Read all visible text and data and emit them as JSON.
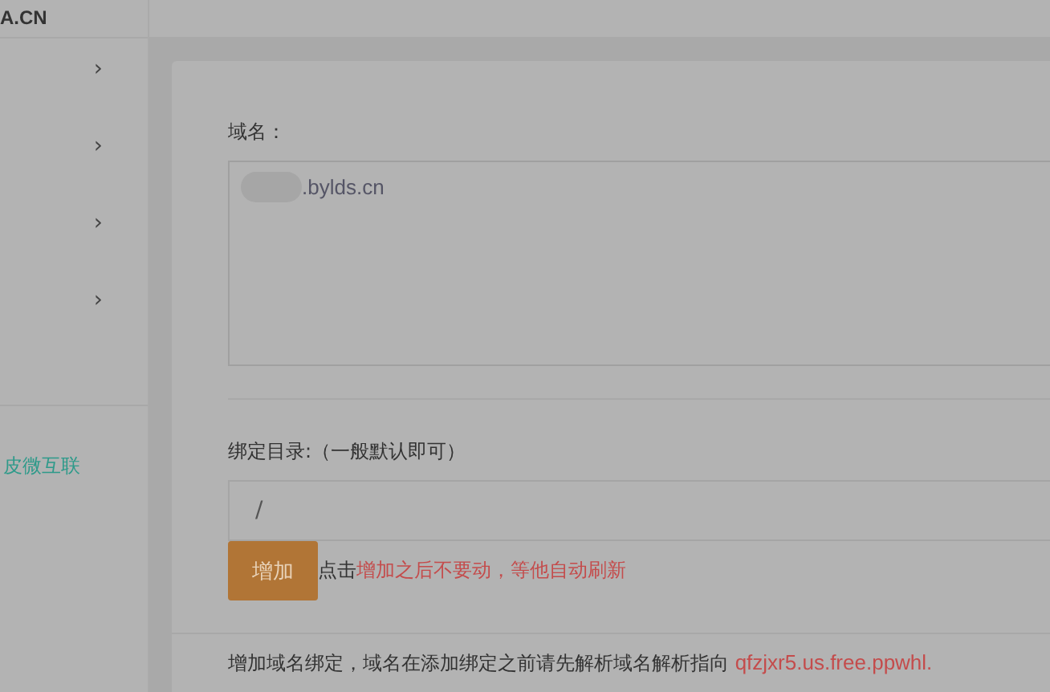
{
  "sidebar": {
    "brand": "A.CN",
    "items": [
      {
        "chevron": "›"
      },
      {
        "chevron": "›"
      },
      {
        "chevron": "›"
      },
      {
        "chevron": "›"
      }
    ],
    "footer_link": "皮微互联"
  },
  "form": {
    "domain_label": "域名：",
    "domain_value": ".bylds.cn",
    "domain_redacted": true,
    "dir_label": "绑定目录:（一般默认即可）",
    "dir_value": "/",
    "add_button": "增加",
    "hint_prefix": "点击",
    "hint_warning": "增加之后不要动，等他自动刷新",
    "note": "增加域名绑定，域名在添加绑定之前请先解析域名解析指向",
    "note_target": "qfzjxr5.us.free.ppwhl."
  }
}
